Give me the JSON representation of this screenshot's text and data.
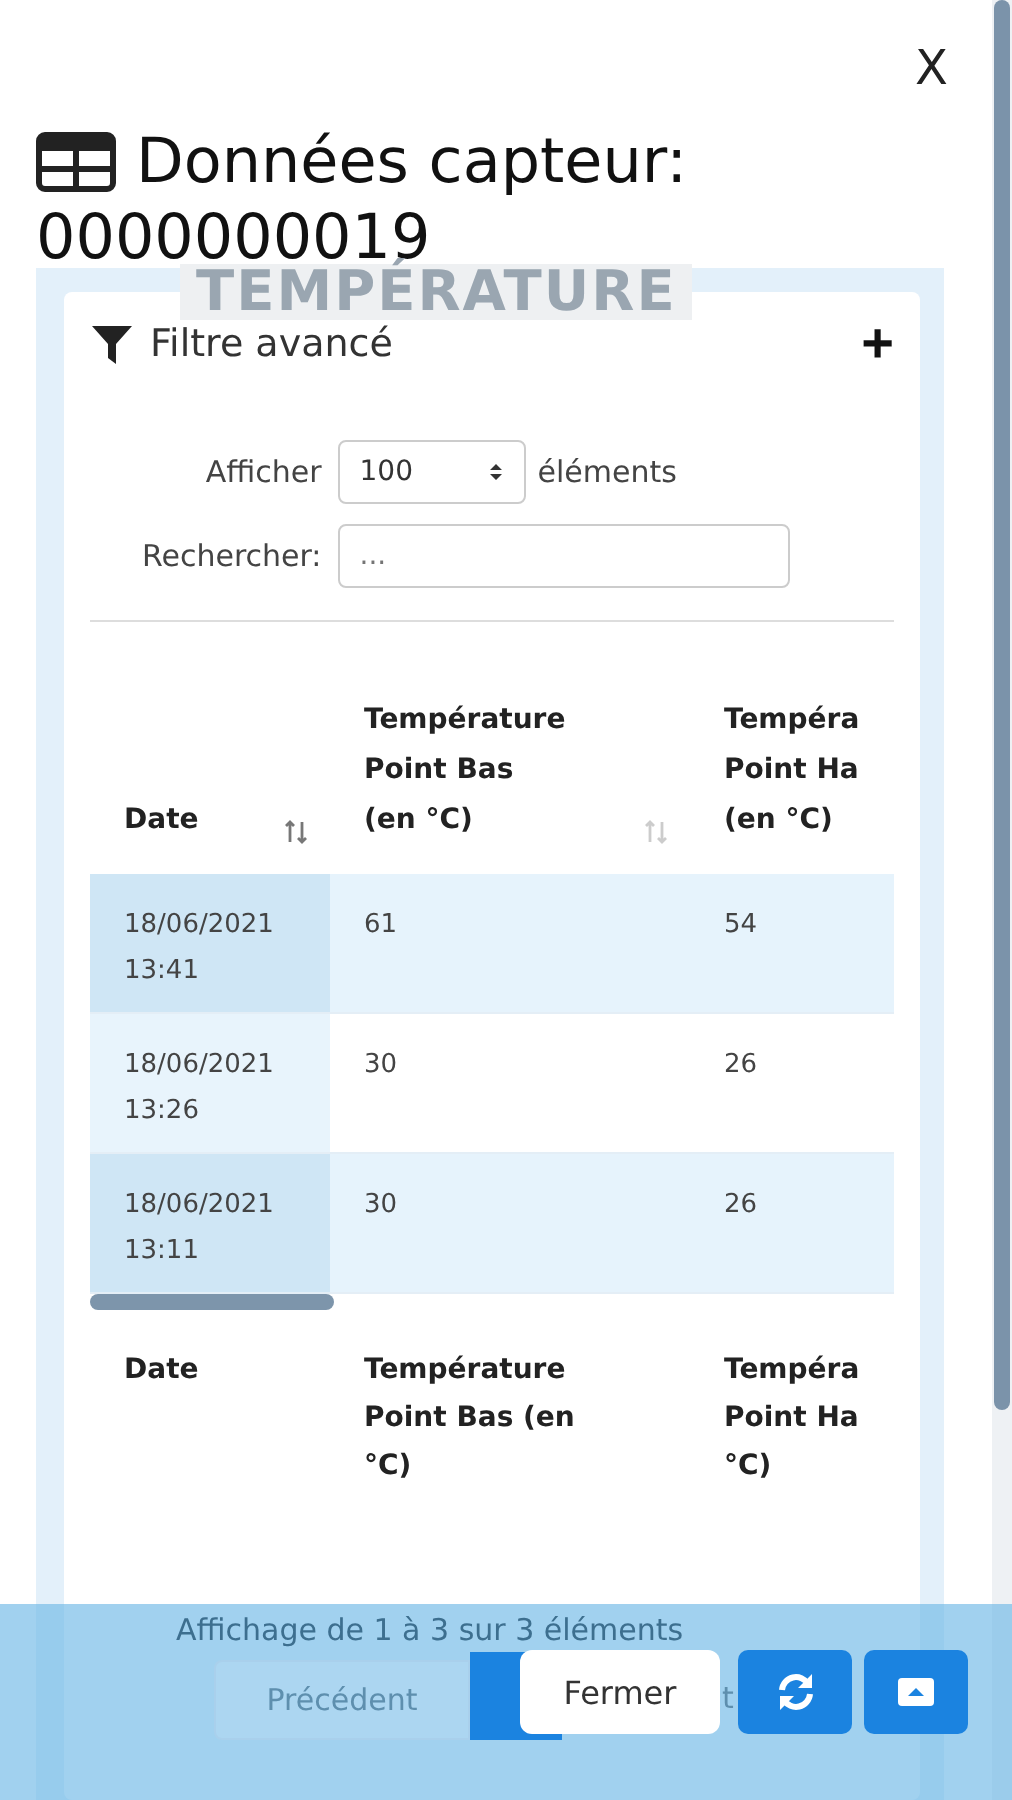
{
  "close_label": "X",
  "title": {
    "line1": "Données capteur:",
    "line2": "0000000019"
  },
  "background_heading": "TEMPÉRATURE",
  "filter": {
    "label": "Filtre avancé",
    "expand_label": "+"
  },
  "length": {
    "before": "Afficher",
    "value": "100",
    "after": "éléments"
  },
  "search": {
    "label": "Rechercher:",
    "placeholder": "..."
  },
  "table": {
    "columns": [
      {
        "lines": [
          "Date"
        ],
        "sortable": true,
        "sorted": true
      },
      {
        "lines": [
          "Température",
          "Point Bas",
          "(en °C)"
        ],
        "sortable": true,
        "sorted": false
      },
      {
        "lines": [
          "Tempéra",
          "Point Ha",
          "(en °C)"
        ],
        "sortable": false,
        "sorted": false
      }
    ],
    "rows": [
      {
        "cells": [
          [
            "18/06/2021",
            "13:41"
          ],
          [
            "61"
          ],
          [
            "54"
          ]
        ]
      },
      {
        "cells": [
          [
            "18/06/2021",
            "13:26"
          ],
          [
            "30"
          ],
          [
            "26"
          ]
        ]
      },
      {
        "cells": [
          [
            "18/06/2021",
            "13:11"
          ],
          [
            "30"
          ],
          [
            "26"
          ]
        ]
      }
    ],
    "footer_columns": [
      [
        "Date"
      ],
      [
        "Température",
        "Point Bas (en",
        "°C)"
      ],
      [
        "Tempéra",
        "Point Ha",
        "°C)"
      ]
    ]
  },
  "info": "Affichage de 1 à 3 sur 3 éléments",
  "pagination": {
    "previous": "Précédent",
    "next_fragment": "t"
  },
  "actions": {
    "close": "Fermer"
  }
}
